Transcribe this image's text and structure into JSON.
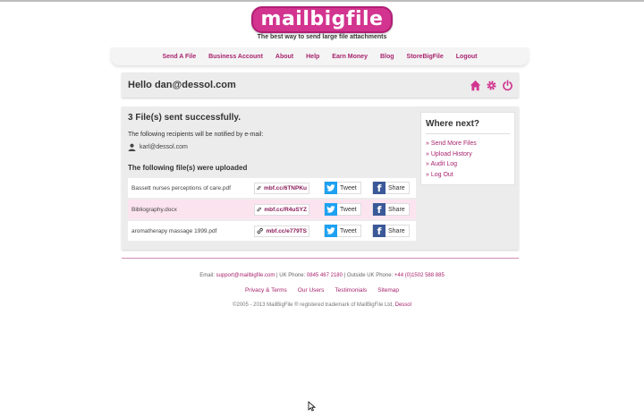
{
  "brand": {
    "logo": "mailbigfile",
    "tagline": "The best way to send large file attachments"
  },
  "nav": [
    "Send A File",
    "Business Account",
    "About",
    "Help",
    "Earn Money",
    "Blog",
    "StoreBigFile",
    "Logout"
  ],
  "greeting": "Hello dan@dessol.com",
  "header_icons": [
    "home-icon",
    "settings-gear-icon",
    "power-icon"
  ],
  "result": {
    "title": "3 File(s) sent successfully.",
    "notify_text": "The following recipients will be notified by e-mail:",
    "recipient": "karl@dessol.com",
    "uploaded_title": "The following file(s) were uploaded",
    "files": [
      {
        "name": "Bassett nurses perceptions of care.pdf",
        "link": "mbf.cc/6TNPKu",
        "tweet": "Tweet",
        "share": "Share"
      },
      {
        "name": "Bibliography.docx",
        "link": "mbf.cc/R4uSYZ",
        "tweet": "Tweet",
        "share": "Share"
      },
      {
        "name": "aromatherapy massage 1999.pdf",
        "link": "mbf.cc/e779TS",
        "tweet": "Tweet",
        "share": "Share"
      }
    ]
  },
  "where_next": {
    "title": "Where next?",
    "items": [
      "» Send More Files",
      "» Upload History",
      "» Audit Log",
      "» Log Out"
    ]
  },
  "footer": {
    "email_label": "Email: ",
    "email": "support@mailbigfile.com",
    "uk_label": " | UK Phone: ",
    "uk_phone": "0845 467 2180",
    "outside_label": " | Outside UK Phone: ",
    "outside_phone": "+44 (0)1502 588 885",
    "links": [
      "Privacy & Terms",
      "Our Users",
      "Testimonials",
      "Sitemap"
    ],
    "copyright": "©2005 - 2013 MailBigFile ® registered trademark of MailBigFile Ltd, ",
    "copyright_link": "Dessol"
  },
  "colors": {
    "brand_pink": "#d2348f",
    "link_pink": "#a8246e",
    "highlight_row": "#fce4ef"
  }
}
